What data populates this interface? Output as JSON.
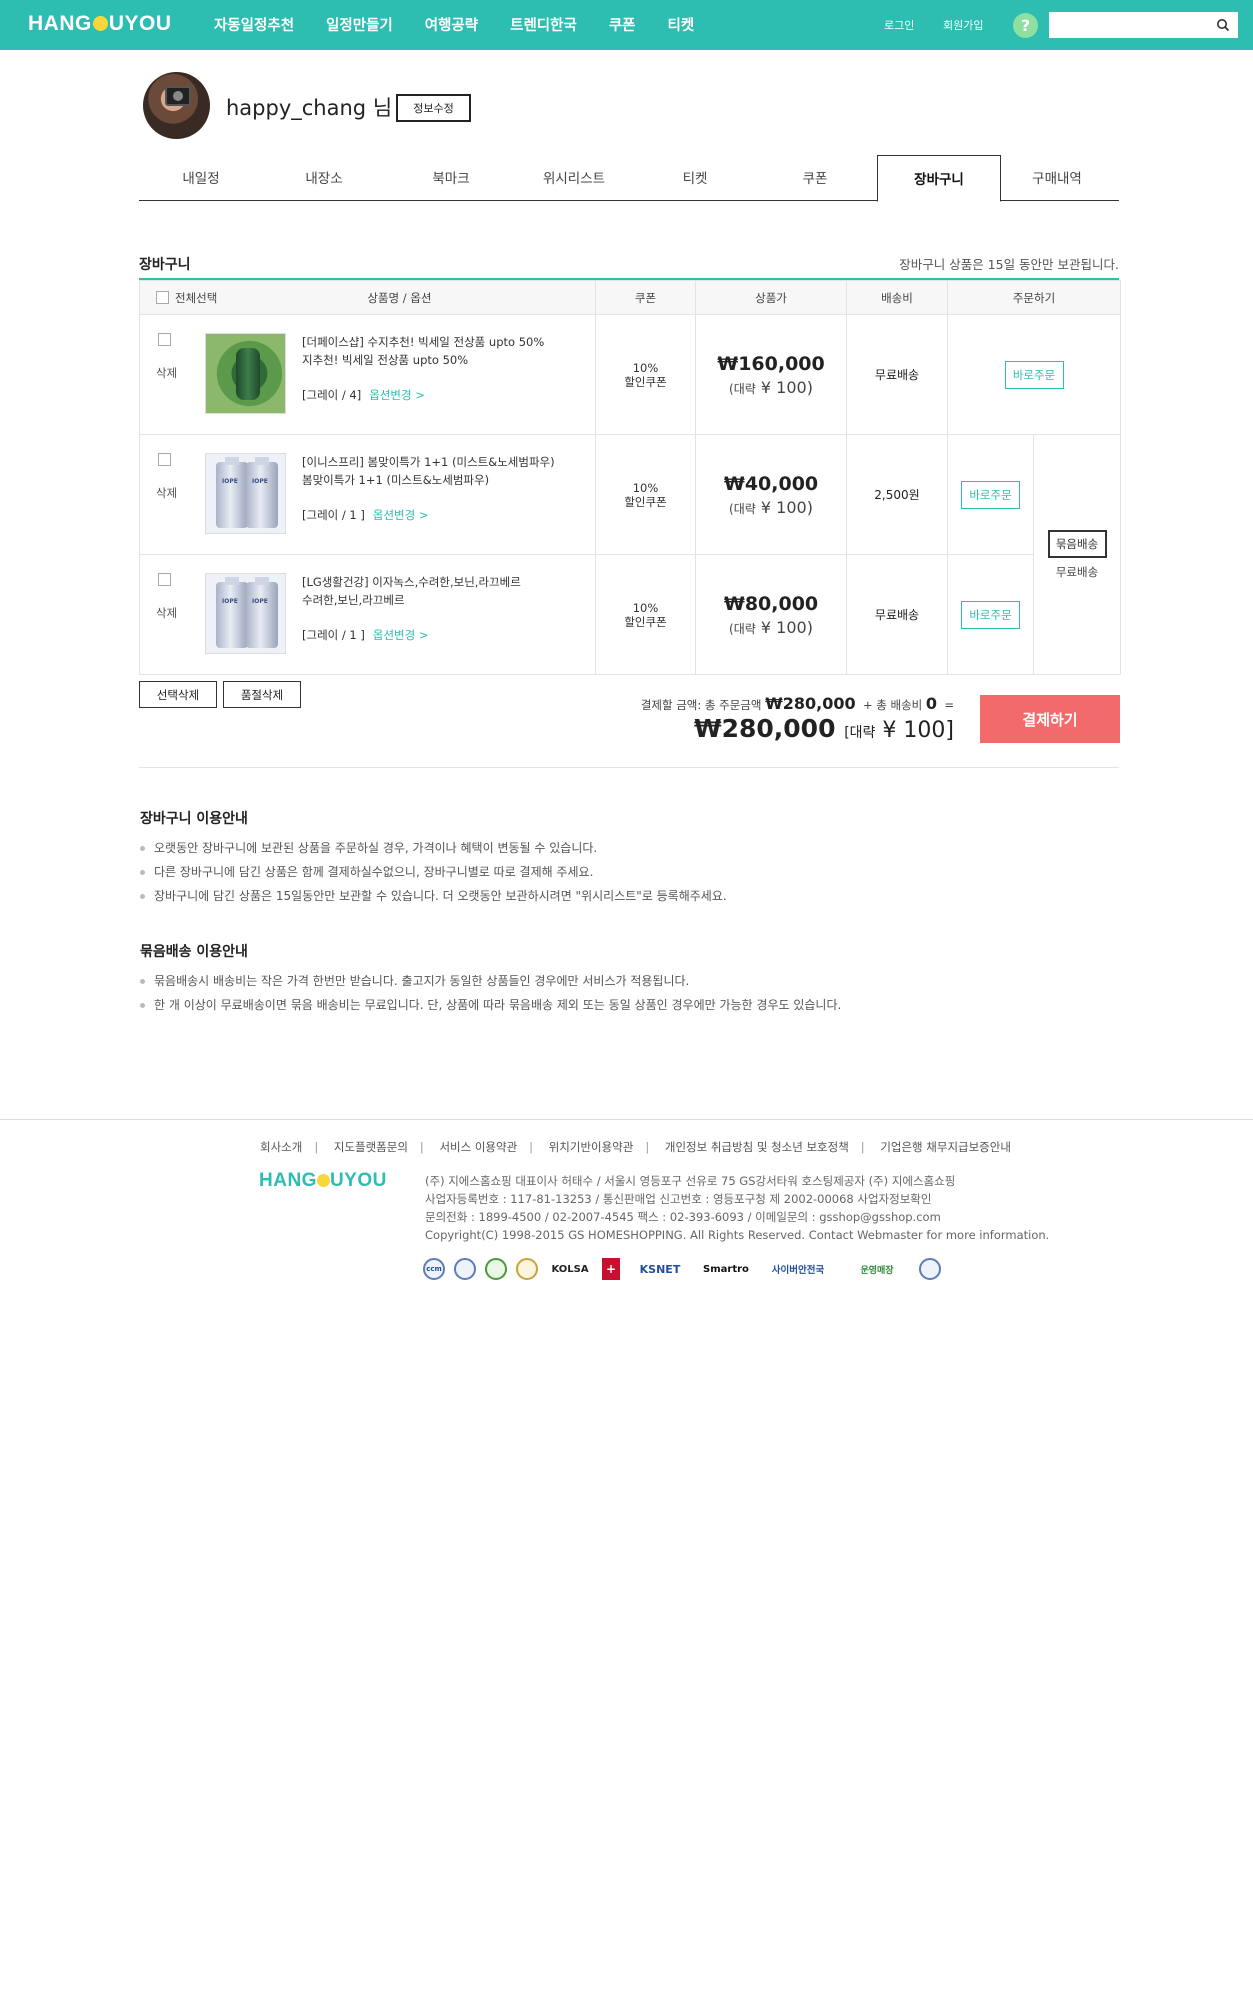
{
  "header": {
    "logo": "HANG",
    "logo_o": "O",
    "logo_rest": "UYOU",
    "menu": [
      "자동일정추천",
      "일정만들기",
      "여행공략",
      "트렌디한국",
      "쿠폰",
      "티켓"
    ],
    "login": "로그인",
    "signup": "회원가입",
    "help": "?",
    "search_placeholder": ""
  },
  "profile": {
    "username": "happy_chang",
    "suffix": "님",
    "edit_label": "정보수정"
  },
  "tabs": [
    "내일정",
    "내장소",
    "북마크",
    "위시리스트",
    "티켓",
    "쿠폰",
    "장바구니",
    "구매내역"
  ],
  "active_tab": "장바구니",
  "cart": {
    "title": "장바구니",
    "note": "장바구니 상품은 15일 동안만 보관됩니다.",
    "columns": {
      "select_all": "전체선택",
      "product": "상품명 / 옵션",
      "coupon": "쿠폰",
      "price": "상품가",
      "shipping": "배송비",
      "order": "주문하기"
    },
    "items": [
      {
        "delete": "삭제",
        "name_line1": "[더페이스샵] 수지추천! 빅세일 전상품 upto 50%",
        "name_line2": "지추천! 빅세일 전상품 upto 50%",
        "option": "[그레이 / 4]",
        "option_change": "옵션변경 >",
        "coupon_pct": "10%",
        "coupon_label": "할인쿠폰",
        "price": "₩160,000",
        "approx_prefix": "(대략",
        "approx_value": "¥ 100)",
        "shipping": "무료배송",
        "order_label": "바로주문"
      },
      {
        "delete": "삭제",
        "name_line1": "[이니스프리] 봄맞이특가 1+1 (미스트&노세범파우)",
        "name_line2": "봄맞이특가 1+1 (미스트&노세범파우)",
        "option": "[그레이 / 1 ]",
        "option_change": "옵션변경 >",
        "coupon_pct": "10%",
        "coupon_label": "할인쿠폰",
        "price": "₩40,000",
        "approx_prefix": "(대략",
        "approx_value": "¥ 100)",
        "shipping": "2,500원",
        "order_label": "바로주문"
      },
      {
        "delete": "삭제",
        "name_line1": "[LG생활건강] 이자녹스,수려한,보닌,라끄베르",
        "name_line2": "수려한,보닌,라끄베르",
        "option": "[그레이 / 1 ]",
        "option_change": "옵션변경 >",
        "coupon_pct": "10%",
        "coupon_label": "할인쿠폰",
        "price": "₩80,000",
        "approx_prefix": "(대략",
        "approx_value": "¥ 100)",
        "shipping": "무료배송",
        "order_label": "바로주문"
      }
    ],
    "bundle_button": "묶음배송",
    "bundle_text": "무료배송",
    "delete_selected": "선택삭제",
    "delete_soldout": "품절삭제",
    "summary_prefix": "결제할 금액: 총 주문금액",
    "summary_amount": "₩280,000",
    "summary_shipping_label": "+ 총 배송비",
    "summary_shipping": "0",
    "summary_eq": "=",
    "total": "₩280,000",
    "total_approx_prefix": "[대략",
    "total_approx_value": "¥ 100]",
    "pay_label": "결제하기"
  },
  "guides": [
    {
      "title": "장바구니 이용안내",
      "items": [
        "오랫동안 장바구니에 보관된 상품을 주문하실 경우, 가격이나 혜택이 변동될 수 있습니다.",
        "다른 장바구니에 담긴 상품은 함께 결제하실수없으니, 장바구니별로 따로 결제해 주세요.",
        "장바구니에 담긴 상품은 15일동안만 보관할 수 있습니다. 더 오랫동안 보관하시려면 \"위시리스트\"로 등록해주세요."
      ]
    },
    {
      "title": "묶음배송 이용안내",
      "items": [
        "묶음배송시 배송비는 작은 가격 한번만 받습니다. 출고지가 동일한 상품들인 경우에만 서비스가 적용됩니다.",
        "한 개 이상이 무료배송이면 묶음 배송비는 무료입니다. 단, 상품에 따라 묶음배송 제외 또는 동일 상품인 경우에만 가능한 경우도 있습니다."
      ]
    }
  ],
  "footer": {
    "links": [
      "회사소개",
      "지도플랫폼문의",
      "서비스 이용약관",
      "위치기반이용약관",
      "개인정보 취급방침 및 청소년 보호정책",
      "기업은행 채무지급보증안내"
    ],
    "info": [
      "(주) 지에스홈쇼핑 대표이사 허태수 / 서울시 영등포구 선유로 75 GS강서타워 호스팅제공자 (주) 지에스홈쇼핑",
      "사업자등록번호 : 117-81-13253 / 통신판매업 신고번호 : 영등포구청 제 2002-00068 사업자정보확인",
      "문의전화 : 1899-4500 / 02-2007-4545 팩스 : 02-393-6093 / 이메일문의 : gsshop@gsshop.com",
      "Copyright(C) 1998-2015 GS HOMESHOPPING. All Rights Reserved. Contact Webmaster for more information."
    ],
    "badges": [
      "ccm",
      "KOLSA",
      "KSNET",
      "Smartro",
      "사이버안전국",
      "운영매장"
    ]
  }
}
